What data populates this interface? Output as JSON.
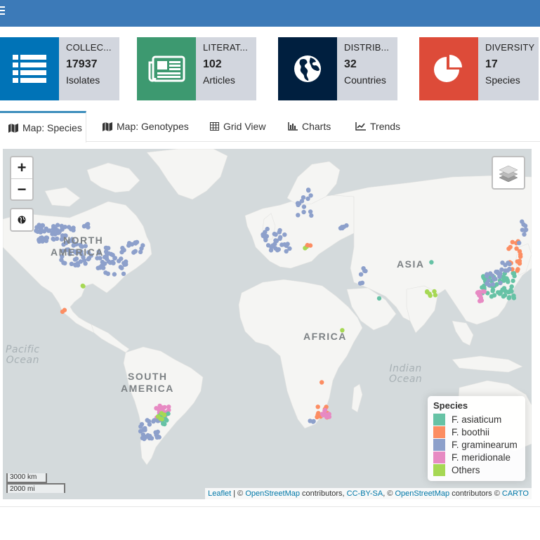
{
  "header": {
    "menu_icon": "hamburger-icon",
    "color": "#3c7ab8"
  },
  "info_boxes": [
    {
      "title": "COLLEC...",
      "number": "17937",
      "sub": "Isolates",
      "icon": "list-icon",
      "color": "#0073b7"
    },
    {
      "title": "LITERAT...",
      "number": "102",
      "sub": "Articles",
      "icon": "newspaper-icon",
      "color": "#3d9970"
    },
    {
      "title": "DISTRIB...",
      "number": "32",
      "sub": "Countries",
      "icon": "globe-americas-icon",
      "color": "#001f3f"
    },
    {
      "title": "DIVERSITY",
      "number": "17",
      "sub": "Species",
      "icon": "pie-chart-icon",
      "color": "#dd4b39"
    }
  ],
  "tabs": [
    {
      "label": "Map: Species",
      "icon": "map-icon",
      "active": true
    },
    {
      "label": "Map: Genotypes",
      "icon": "map-icon",
      "active": false
    },
    {
      "label": "Grid View",
      "icon": "table-icon",
      "active": false
    },
    {
      "label": "Charts",
      "icon": "bar-chart-icon",
      "active": false
    },
    {
      "label": "Trends",
      "icon": "line-chart-icon",
      "active": false
    }
  ],
  "map": {
    "zoom_in": "+",
    "zoom_out": "−",
    "labels": {
      "north_america_1": "NORTH",
      "north_america_2": "AMERICA",
      "south_america_1": "SOUTH",
      "south_america_2": "AMERICA",
      "africa": "AFRICA",
      "asia": "ASIA",
      "pacific_1": "Pacific",
      "pacific_2": "Ocean",
      "indian_1": "Indian",
      "indian_2": "Ocean"
    },
    "legend": {
      "title": "Species",
      "items": [
        {
          "label": "F. asiaticum",
          "color": "#66c2a5"
        },
        {
          "label": "F. boothii",
          "color": "#fc8d62"
        },
        {
          "label": "F. graminearum",
          "color": "#8da0cb"
        },
        {
          "label": "F. meridionale",
          "color": "#e78ac3"
        },
        {
          "label": "Others",
          "color": "#a6d854"
        }
      ]
    },
    "scale": {
      "km": "3000 km",
      "mi": "2000 mi"
    },
    "attribution": {
      "leaflet": "Leaflet",
      "sep1": " | © ",
      "osm1": "OpenStreetMap",
      "contrib1": " contributors, ",
      "ccbysa": "CC-BY-SA",
      "sep2": ", © ",
      "osm2": "OpenStreetMap",
      "contrib2": " contributors © ",
      "carto": "CARTO"
    }
  }
}
